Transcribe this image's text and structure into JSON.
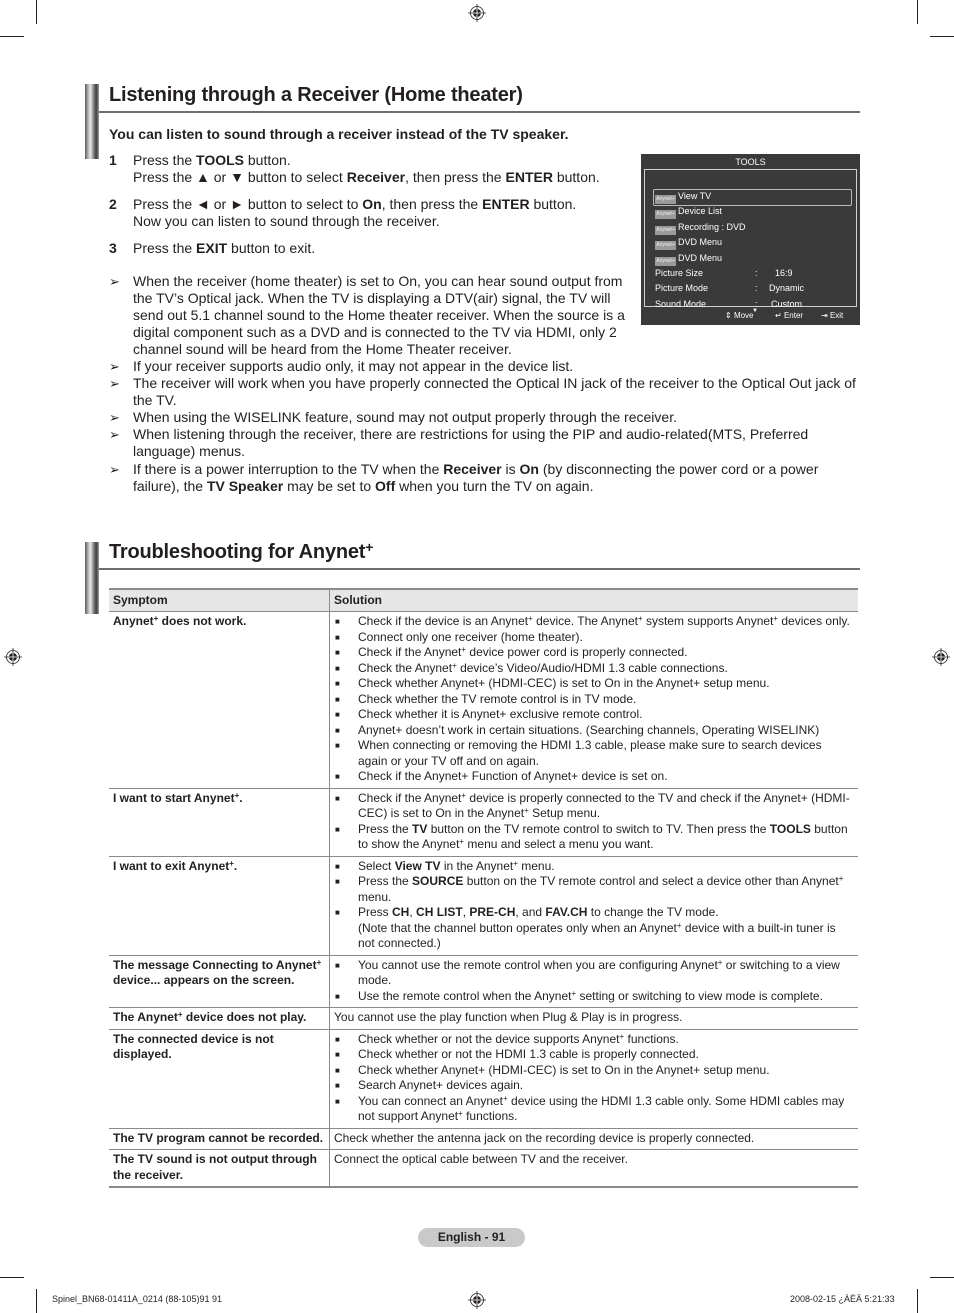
{
  "section1": {
    "title": "Listening through a Receiver (Home theater)",
    "intro": "You can listen to sound through a receiver instead of the TV speaker.",
    "steps": [
      {
        "num": "1",
        "lines": [
          "Press the <b>TOOLS</b> button.",
          "Press the ▲ or ▼ button to select <b>Receiver</b>, then press the <b>ENTER</b> button."
        ]
      },
      {
        "num": "2",
        "lines": [
          "Press the ◄ or ► button to select to <b>On</b>, then press the <b>ENTER</b> button.",
          "Now you can listen to sound through the receiver."
        ]
      },
      {
        "num": "3",
        "lines": [
          "Press the <b>EXIT</b> button to exit."
        ]
      }
    ],
    "notes": [
      "When the receiver (home theater) is set to On, you can hear sound output from the TV’s Optical jack. When the TV is displaying a DTV(air) signal, the TV will send out 5.1 channel sound to the Home theater receiver. When the source is a digital component such as a DVD and is connected to the TV via HDMI, only 2 channel sound will be heard from the Home Theater receiver.",
      "If your receiver supports audio only, it may not appear in the device list.",
      "The receiver will work when you have properly connected the Optical IN jack of the receiver to the Optical Out jack of the TV.",
      "When using the WISELINK feature, sound may not output properly through the receiver.",
      "When listening through the receiver, there are restrictions for using the PIP and audio-related(MTS, Preferred language) menus.",
      "If there is a power interruption to the TV when the <b>Receiver</b> is <b>On</b> (by disconnecting the power cord or a power failure), the <b>TV Speaker</b> may be set to <b>Off</b> when you turn the TV on again."
    ],
    "note_arrow_icon": "➢"
  },
  "osd": {
    "title": "TOOLS",
    "badge_text": "Anynet+",
    "items": [
      "View TV",
      "Device List",
      "Recording : DVD",
      "DVD Menu",
      "DVD Menu"
    ],
    "settings": [
      {
        "label": "Picture Size",
        "value": "16:9"
      },
      {
        "label": "Picture Mode",
        "value": "Dynamic"
      },
      {
        "label": "Sound Mode",
        "value": "Custom"
      }
    ],
    "colon": ":",
    "scroll_down_icon": "▼",
    "footer": {
      "move": "Move",
      "enter": "Enter",
      "exit": "Exit",
      "move_icon": "⇕",
      "enter_icon": "↵",
      "exit_icon": "⇥"
    }
  },
  "section2": {
    "title": "Troubleshooting for Anynet",
    "title_sup": "+",
    "table": {
      "headers": [
        "Symptom",
        "Solution"
      ],
      "rows": [
        {
          "symptom": "Anynet<sup>+</sup> does not work.",
          "solutions": [
            "Check if the device is an Anynet<sup>+</sup> device. The Anynet<sup>+</sup> system supports Anynet<sup>+</sup> devices only.",
            "Connect only one receiver (home theater).",
            "Check if the Anynet<sup>+</sup> device power cord is properly connected.",
            "Check the Anynet<sup>+</sup> device’s Video/Audio/HDMI 1.3 cable connections.",
            "Check whether Anynet+ (HDMI-CEC) is set to On in the Anynet+ setup menu.",
            "Check whether the TV remote control is in TV mode.",
            "Check whether it is Anynet+ exclusive remote control.",
            "Anynet+ doesn’t work in certain situations. (Searching channels, Operating WISELINK)",
            "When connecting or removing the HDMI 1.3 cable, please make sure to search devices again or your TV off and on again.",
            "Check if the Anynet+ Function of Anynet+ device is set on."
          ]
        },
        {
          "symptom": "I want to start Anynet<sup>+</sup>.",
          "solutions": [
            "Check if the Anynet<sup>+</sup> device is properly connected to the TV and check if the Anynet+ (HDMI-CEC) is set to On in the Anynet<sup>+</sup> Setup menu.",
            "Press the <b>TV</b> button on the TV remote control to switch to TV. Then press the <b>TOOLS</b> button to show the Anynet<sup>+</sup> menu and select a menu you want."
          ]
        },
        {
          "symptom": "I want to exit Anynet<sup>+</sup>.",
          "solutions": [
            "Select <b>View TV</b> in the Anynet<sup>+</sup> menu.",
            "Press the <b>SOURCE</b> button on the TV remote control and select a device other than Anynet<sup>+</sup> menu.",
            "Press <b>CH</b>, <b>CH LIST</b>, <b>PRE-CH</b>, and <b>FAV.CH</b> to change the TV mode.<br>(Note that the channel button operates only when an Anynet<sup>+</sup> device with a built-in tuner is not connected.)"
          ]
        },
        {
          "symptom": "The message Connecting to Anynet<sup>+</sup> device... appears on the screen.",
          "solutions": [
            "You cannot use the remote control when you are configuring Anynet<sup>+</sup> or switching to a view mode.",
            "Use the remote control when the Anynet<sup>+</sup> setting or switching to view mode is complete."
          ]
        },
        {
          "symptom": "The Anynet<sup>+</sup> device does not play.",
          "plain": "You cannot use the play function when Plug &amp; Play is in progress."
        },
        {
          "symptom": "The connected device is not displayed.",
          "solutions": [
            "Check whether or not the device supports Anynet<sup>+</sup> functions.",
            "Check whether or not the HDMI 1.3 cable is properly connected.",
            "Check whether Anynet+ (HDMI-CEC) is set to On in the Anynet+ setup menu.",
            "Search Anynet+ devices again.",
            "You can connect an Anynet<sup>+</sup> device using the HDMI 1.3 cable only. Some HDMI cables may not support Anynet<sup>+</sup> functions."
          ]
        },
        {
          "symptom": "The TV program cannot be recorded.",
          "plain": "Check whether the antenna jack on the recording device is properly connected."
        },
        {
          "symptom": "The TV sound is not output through the receiver.",
          "plain": "Connect the optical cable between TV and the receiver."
        }
      ]
    }
  },
  "footer": {
    "page_label": "English - 91",
    "slug_left": "Spinel_BN68-01411A_0214 (88-105)91   91",
    "slug_right": "2008-02-15   ¿ÀÈÄ 5:21:33"
  }
}
